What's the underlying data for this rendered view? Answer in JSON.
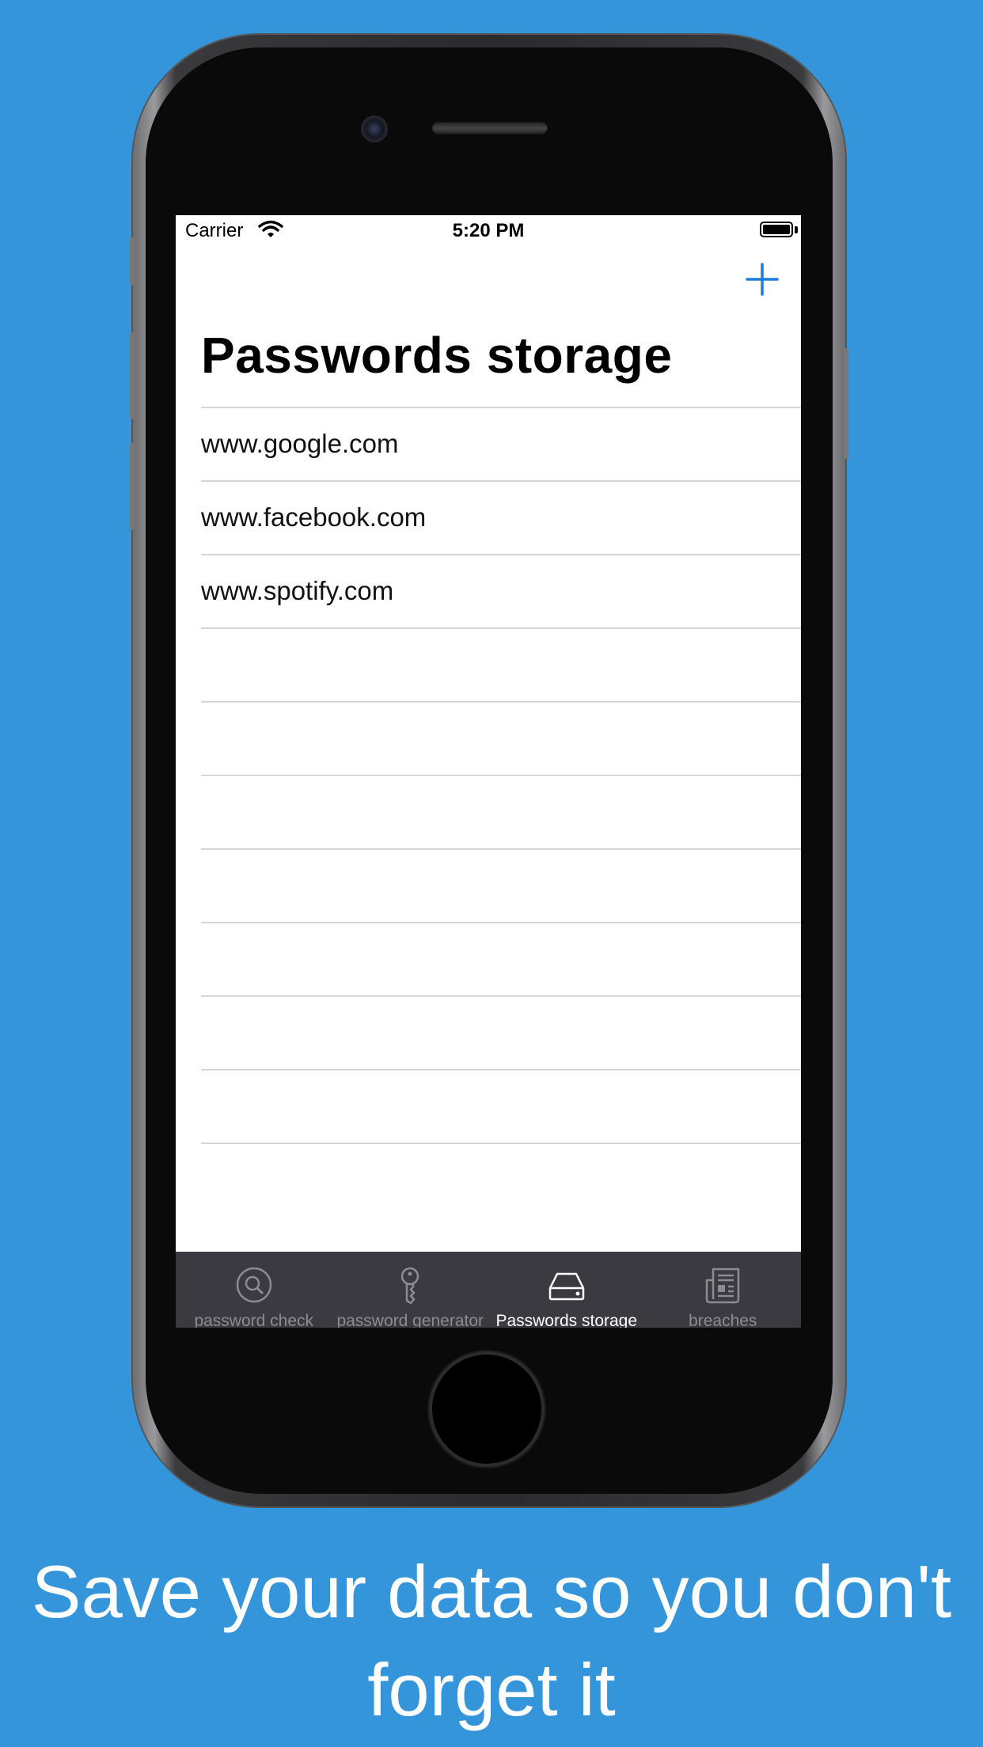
{
  "status_bar": {
    "carrier": "Carrier",
    "time": "5:20 PM"
  },
  "nav": {
    "title": "Passwords storage",
    "add_icon": "plus-icon"
  },
  "list": {
    "items": [
      {
        "label": "www.google.com"
      },
      {
        "label": "www.facebook.com"
      },
      {
        "label": "www.spotify.com"
      },
      {
        "label": ""
      },
      {
        "label": ""
      },
      {
        "label": ""
      },
      {
        "label": ""
      },
      {
        "label": ""
      },
      {
        "label": ""
      },
      {
        "label": ""
      },
      {
        "label": ""
      }
    ]
  },
  "tabbar": {
    "tabs": [
      {
        "label": "password check",
        "icon": "magnifier-icon",
        "active": false
      },
      {
        "label": "password generator",
        "icon": "key-icon",
        "active": false
      },
      {
        "label": "Passwords storage",
        "icon": "hard-drive-icon",
        "active": true
      },
      {
        "label": "breaches",
        "icon": "newspaper-icon",
        "active": false
      }
    ]
  },
  "caption": {
    "text": "Save your data so you don't forget it"
  },
  "colors": {
    "background": "#3595DB",
    "accent": "#1C7CE0",
    "tabbar": "#3B3A40"
  }
}
